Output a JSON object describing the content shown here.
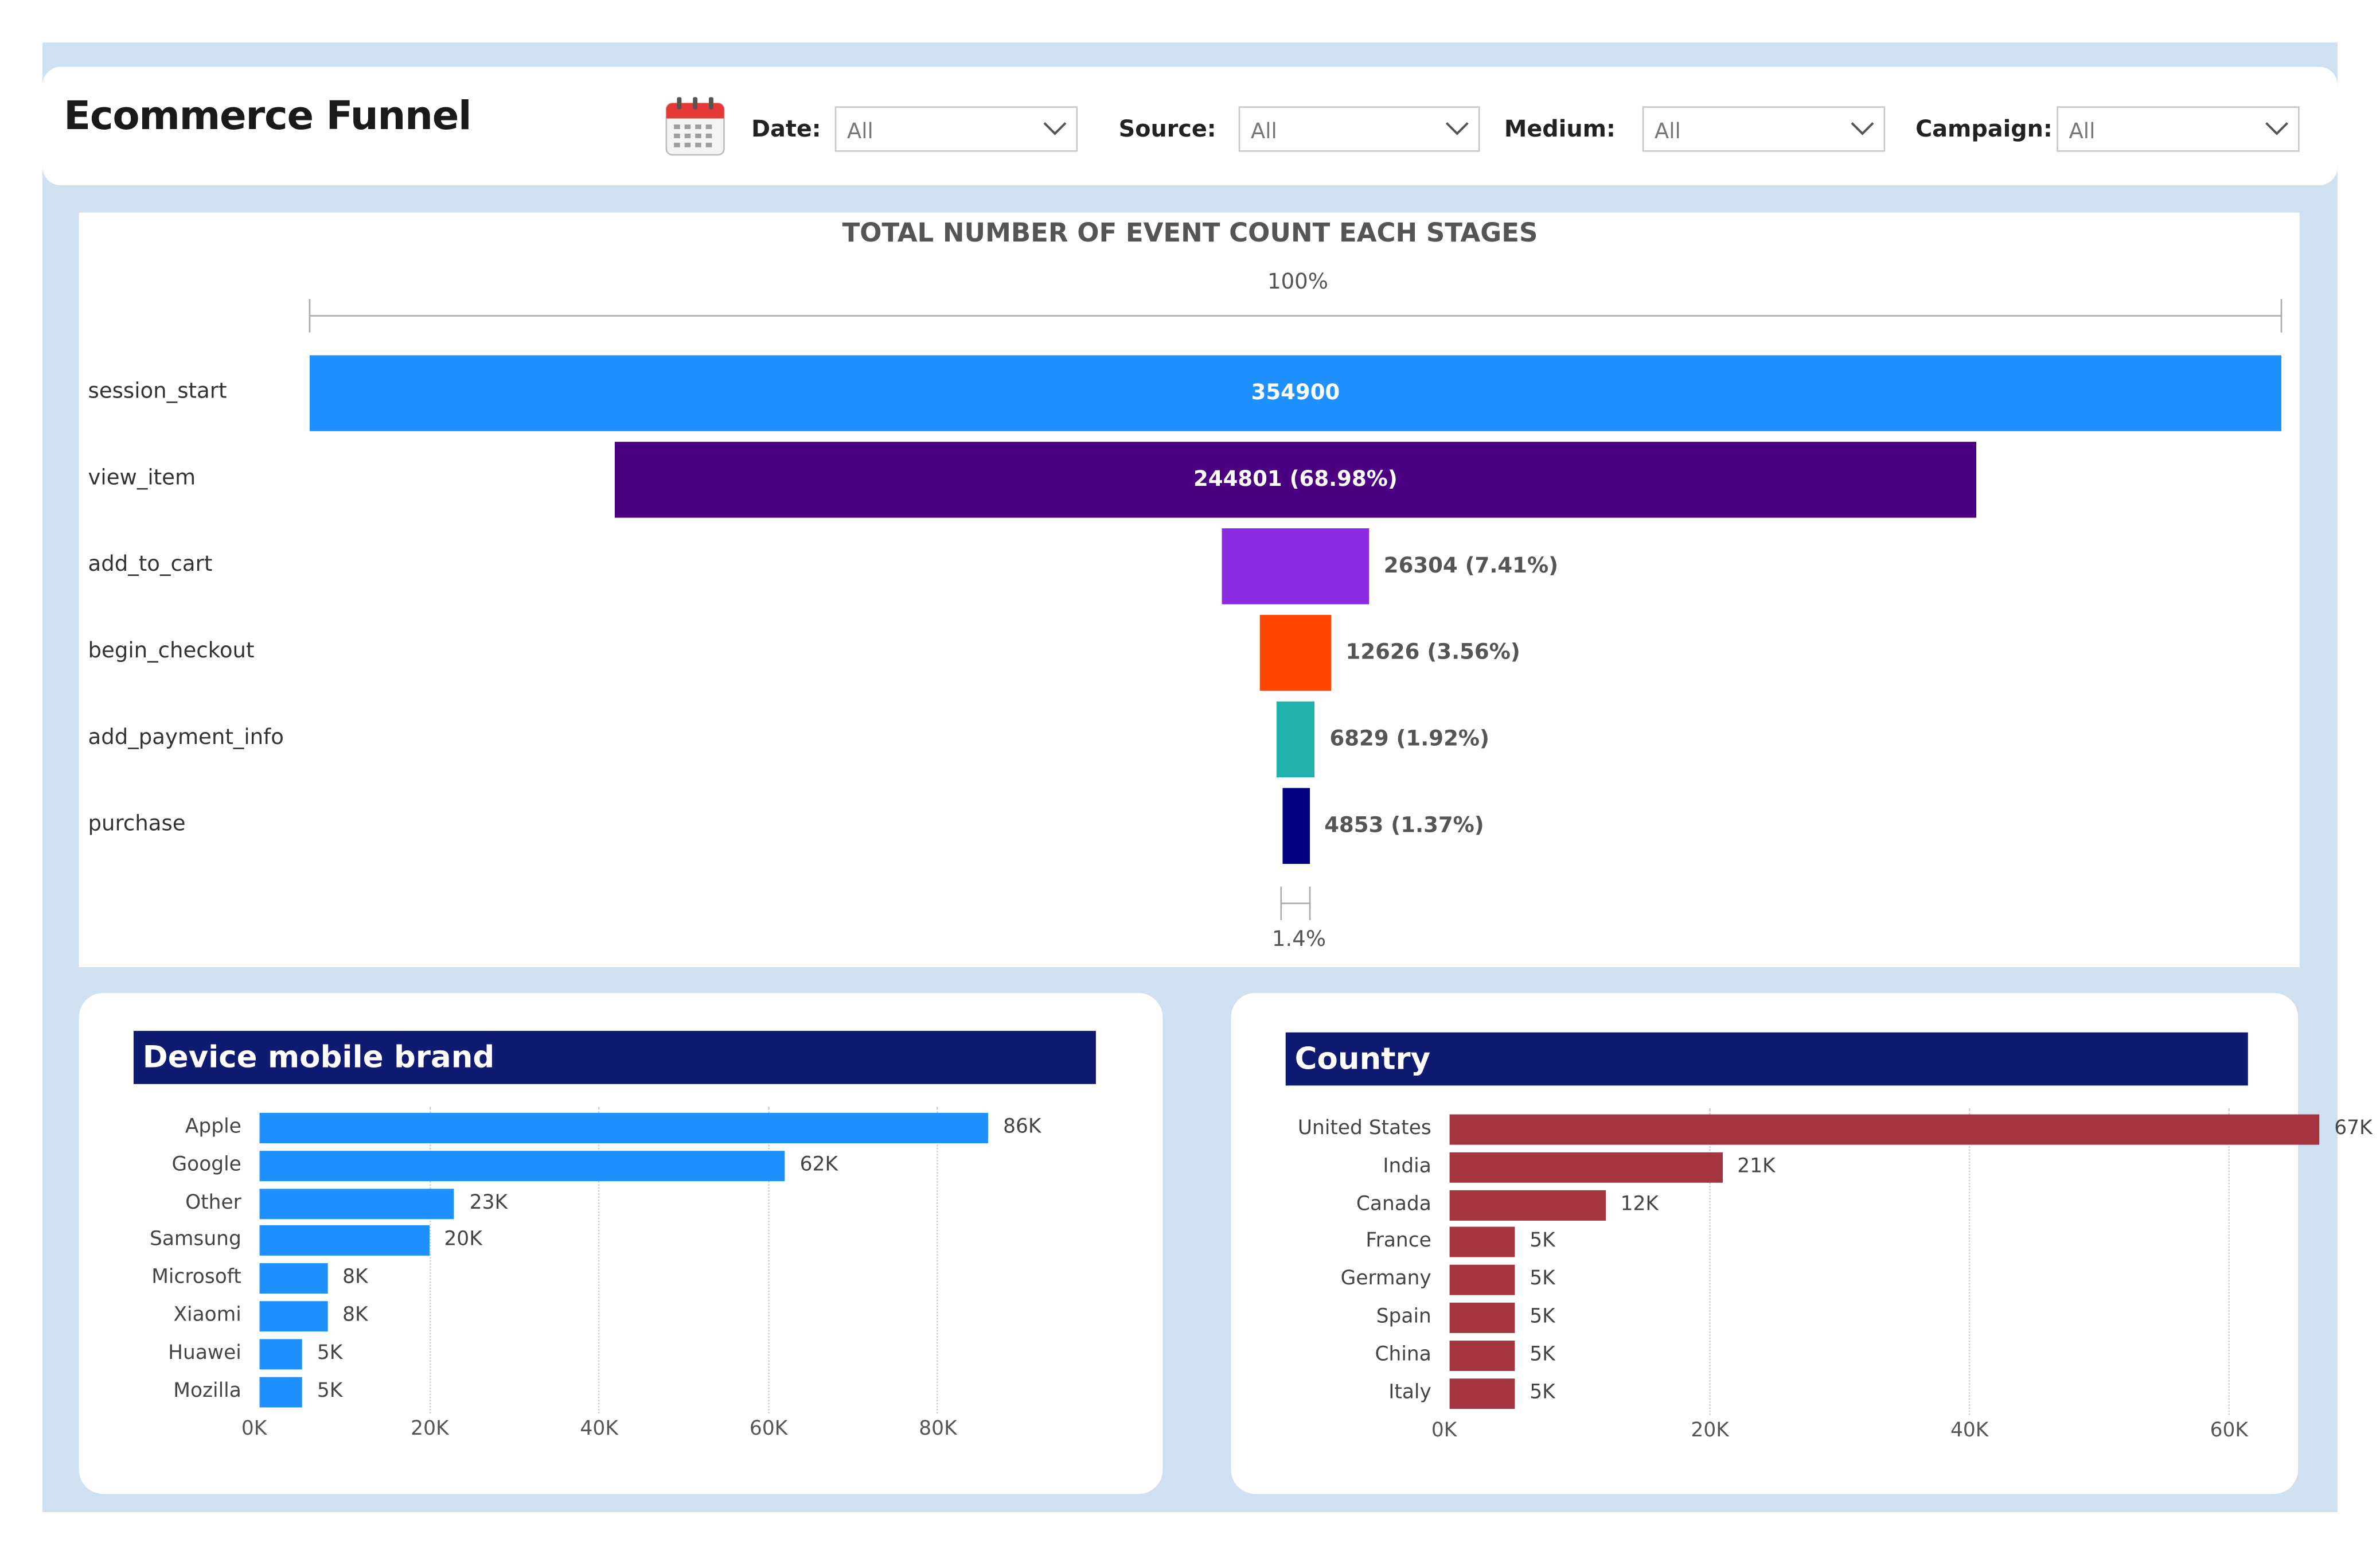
{
  "header": {
    "title": "Ecommerce Funnel",
    "filters": [
      {
        "label": "Date:",
        "value": "All"
      },
      {
        "label": "Source:",
        "value": "All"
      },
      {
        "label": "Medium:",
        "value": "All"
      },
      {
        "label": "Campaign:",
        "value": "All"
      }
    ]
  },
  "funnel": {
    "title": "TOTAL NUMBER OF EVENT COUNT EACH STAGES",
    "top_pct": "100%",
    "bottom_pct": "1.4%",
    "stages": [
      {
        "label": "session_start",
        "value": 354900,
        "display": "354900",
        "color": "#1e90ff"
      },
      {
        "label": "view_item",
        "value": 244801,
        "display": "244801 (68.98%)",
        "color": "#4b0082"
      },
      {
        "label": "add_to_cart",
        "value": 26304,
        "display": "26304 (7.41%)",
        "color": "#8a2be2"
      },
      {
        "label": "begin_checkout",
        "value": 12626,
        "display": "12626 (3.56%)",
        "color": "#ff4500"
      },
      {
        "label": "add_payment_info",
        "value": 6829,
        "display": "6829 (1.92%)",
        "color": "#20b2aa"
      },
      {
        "label": "purchase",
        "value": 4853,
        "display": "4853 (1.37%)",
        "color": "#000080"
      }
    ]
  },
  "device": {
    "title": "Device mobile brand",
    "bar_color": "#1e90ff",
    "ticks": [
      "0K",
      "20K",
      "40K",
      "60K",
      "80K"
    ],
    "max": 100000,
    "categories": [
      "Apple",
      "Google",
      "Other",
      "Samsung",
      "Microsoft",
      "Xiaomi",
      "Huawei",
      "Mozilla"
    ],
    "values": [
      86000,
      62000,
      23000,
      20000,
      8000,
      8000,
      5000,
      5000
    ],
    "labels": [
      "86K",
      "62K",
      "23K",
      "20K",
      "8K",
      "8K",
      "5K",
      "5K"
    ]
  },
  "country": {
    "title": "Country",
    "bar_color": "#a4343f",
    "ticks": [
      "0K",
      "20K",
      "40K",
      "60K"
    ],
    "max": 80000,
    "categories": [
      "United States",
      "India",
      "Canada",
      "France",
      "Germany",
      "Spain",
      "China",
      "Italy"
    ],
    "values": [
      67000,
      21000,
      12000,
      5000,
      5000,
      5000,
      5000,
      5000
    ],
    "labels": [
      "67K",
      "21K",
      "12K",
      "5K",
      "5K",
      "5K",
      "5K",
      "5K"
    ]
  },
  "chart_data": [
    {
      "type": "bar",
      "title": "TOTAL NUMBER OF EVENT COUNT EACH STAGES",
      "categories": [
        "session_start",
        "view_item",
        "add_to_cart",
        "begin_checkout",
        "add_payment_info",
        "purchase"
      ],
      "values": [
        354900,
        244801,
        26304,
        12626,
        6829,
        4853
      ],
      "percent_of_first": [
        100,
        68.98,
        7.41,
        3.56,
        1.92,
        1.37
      ]
    },
    {
      "type": "bar",
      "title": "Device mobile brand",
      "categories": [
        "Apple",
        "Google",
        "Other",
        "Samsung",
        "Microsoft",
        "Xiaomi",
        "Huawei",
        "Mozilla"
      ],
      "values": [
        86000,
        62000,
        23000,
        20000,
        8000,
        8000,
        5000,
        5000
      ],
      "xlim": [
        0,
        100000
      ],
      "grid": true
    },
    {
      "type": "bar",
      "title": "Country",
      "categories": [
        "United States",
        "India",
        "Canada",
        "France",
        "Germany",
        "Spain",
        "China",
        "Italy"
      ],
      "values": [
        67000,
        21000,
        12000,
        5000,
        5000,
        5000,
        5000,
        5000
      ],
      "xlim": [
        0,
        80000
      ],
      "grid": true
    }
  ]
}
